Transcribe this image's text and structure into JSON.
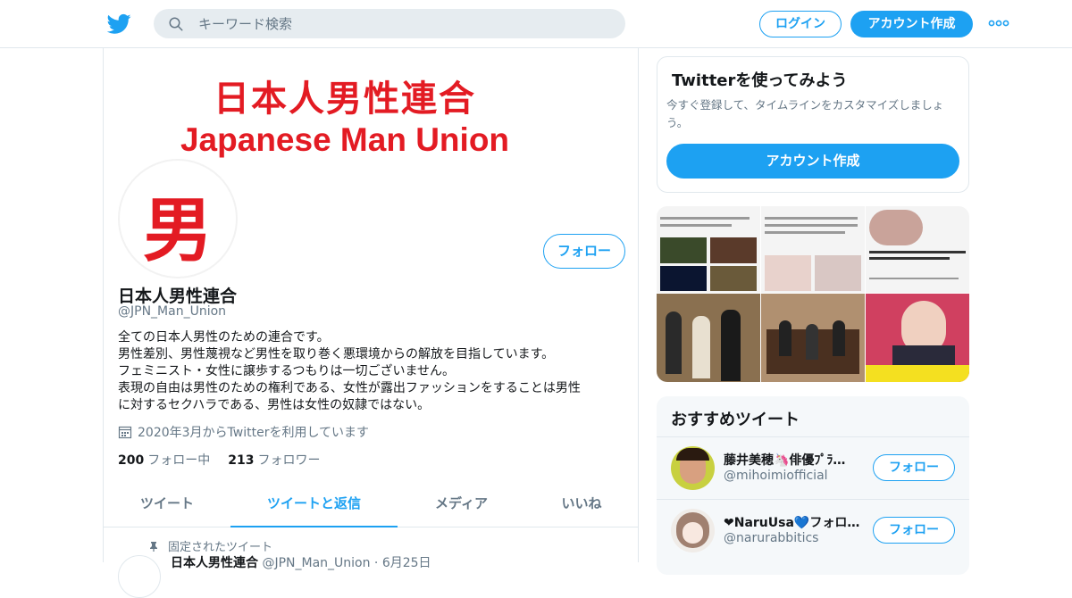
{
  "header": {
    "search_placeholder": "キーワード検索",
    "login_label": "ログイン",
    "signup_label": "アカウント作成"
  },
  "profile": {
    "banner_line1": "日本人男性連合",
    "banner_line2": "Japanese Man Union",
    "avatar_char": "男",
    "follow_label": "フォロー",
    "name": "日本人男性連合",
    "handle": "@JPN_Man_Union",
    "bio_lines": [
      "全ての日本人男性のための連合です。",
      "男性差別、男性蔑視など男性を取り巻く悪環境からの解放を目指しています。",
      "フェミニスト・女性に譲歩するつもりは一切ございません。",
      "表現の自由は男性のための権利である、女性が露出ファッションをすることは男性",
      "に対するセクハラである、男性は女性の奴隷ではない。"
    ],
    "joined": "2020年3月からTwitterを利用しています",
    "following_count": "200",
    "following_label": "フォロー中",
    "followers_count": "213",
    "followers_label": "フォロワー"
  },
  "tabs": [
    {
      "label": "ツイート"
    },
    {
      "label": "ツイートと返信"
    },
    {
      "label": "メディア"
    },
    {
      "label": "いいね"
    }
  ],
  "pinned": {
    "label": "固定されたツイート",
    "name": "日本人男性連合",
    "meta": "@JPN_Man_Union · 6月25日"
  },
  "sidebar": {
    "card_title": "Twitterを使ってみよう",
    "card_text": "今すぐ登録して、タイムラインをカスタマイズしましょう。",
    "card_button": "アカウント作成",
    "recs_title": "おすすめツイート",
    "recs": [
      {
        "name": "藤井美穂🦄俳優ﾌﾟﾗ…",
        "handle": "@mihoimiofficial",
        "follow": "フォロー"
      },
      {
        "name": "❤NaruUsa💙フォロ…",
        "handle": "@narurabbitics",
        "follow": "フォロー"
      }
    ]
  },
  "colors": {
    "accent": "#1da1f2",
    "banner_red": "#e31b23"
  }
}
